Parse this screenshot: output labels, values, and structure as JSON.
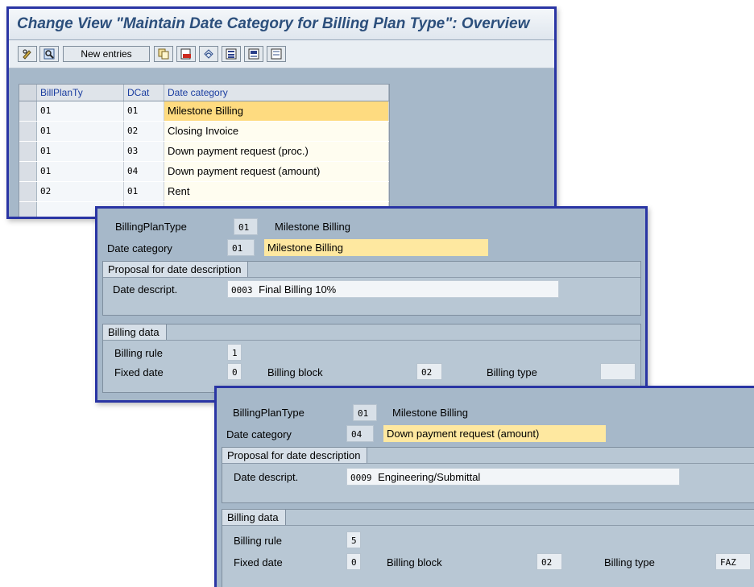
{
  "window1": {
    "title": "Change View \"Maintain Date Category for Billing Plan Type\": Overview",
    "toolbar": {
      "new_entries_label": "New entries"
    },
    "table": {
      "columns": [
        "BillPlanTy",
        "DCat",
        "Date category"
      ],
      "rows": [
        {
          "plan": "01",
          "dcat": "01",
          "desc": "Milestone Billing"
        },
        {
          "plan": "01",
          "dcat": "02",
          "desc": "Closing Invoice"
        },
        {
          "plan": "01",
          "dcat": "03",
          "desc": "Down payment request (proc.)"
        },
        {
          "plan": "01",
          "dcat": "04",
          "desc": "Down payment request (amount)"
        },
        {
          "plan": "02",
          "dcat": "01",
          "desc": "Rent"
        }
      ]
    }
  },
  "detail1": {
    "plan_type_label": "BillingPlanType",
    "plan_type_value": "01",
    "plan_type_desc": "Milestone Billing",
    "date_category_label": "Date category",
    "date_category_value": "01",
    "date_category_desc": "Milestone Billing",
    "proposal_title": "Proposal for date description",
    "date_descript_label": "Date descript.",
    "date_descript_code": "0003",
    "date_descript_text": "Final Billing 10%",
    "billing_data_title": "Billing data",
    "billing_rule_label": "Billing rule",
    "billing_rule_value": "1",
    "fixed_date_label": "Fixed date",
    "fixed_date_value": "0",
    "billing_block_label": "Billing block",
    "billing_block_value": "02",
    "billing_type_label": "Billing type",
    "billing_type_value": ""
  },
  "detail2": {
    "plan_type_label": "BillingPlanType",
    "plan_type_value": "01",
    "plan_type_desc": "Milestone Billing",
    "date_category_label": "Date category",
    "date_category_value": "04",
    "date_category_desc": "Down payment request (amount)",
    "proposal_title": "Proposal for date description",
    "date_descript_label": "Date descript.",
    "date_descript_code": "0009",
    "date_descript_text": "Engineering/Submittal",
    "billing_data_title": "Billing data",
    "billing_rule_label": "Billing rule",
    "billing_rule_value": "5",
    "fixed_date_label": "Fixed date",
    "fixed_date_value": "0",
    "billing_block_label": "Billing block",
    "billing_block_value": "02",
    "billing_type_label": "Billing type",
    "billing_type_value": "FAZ"
  }
}
